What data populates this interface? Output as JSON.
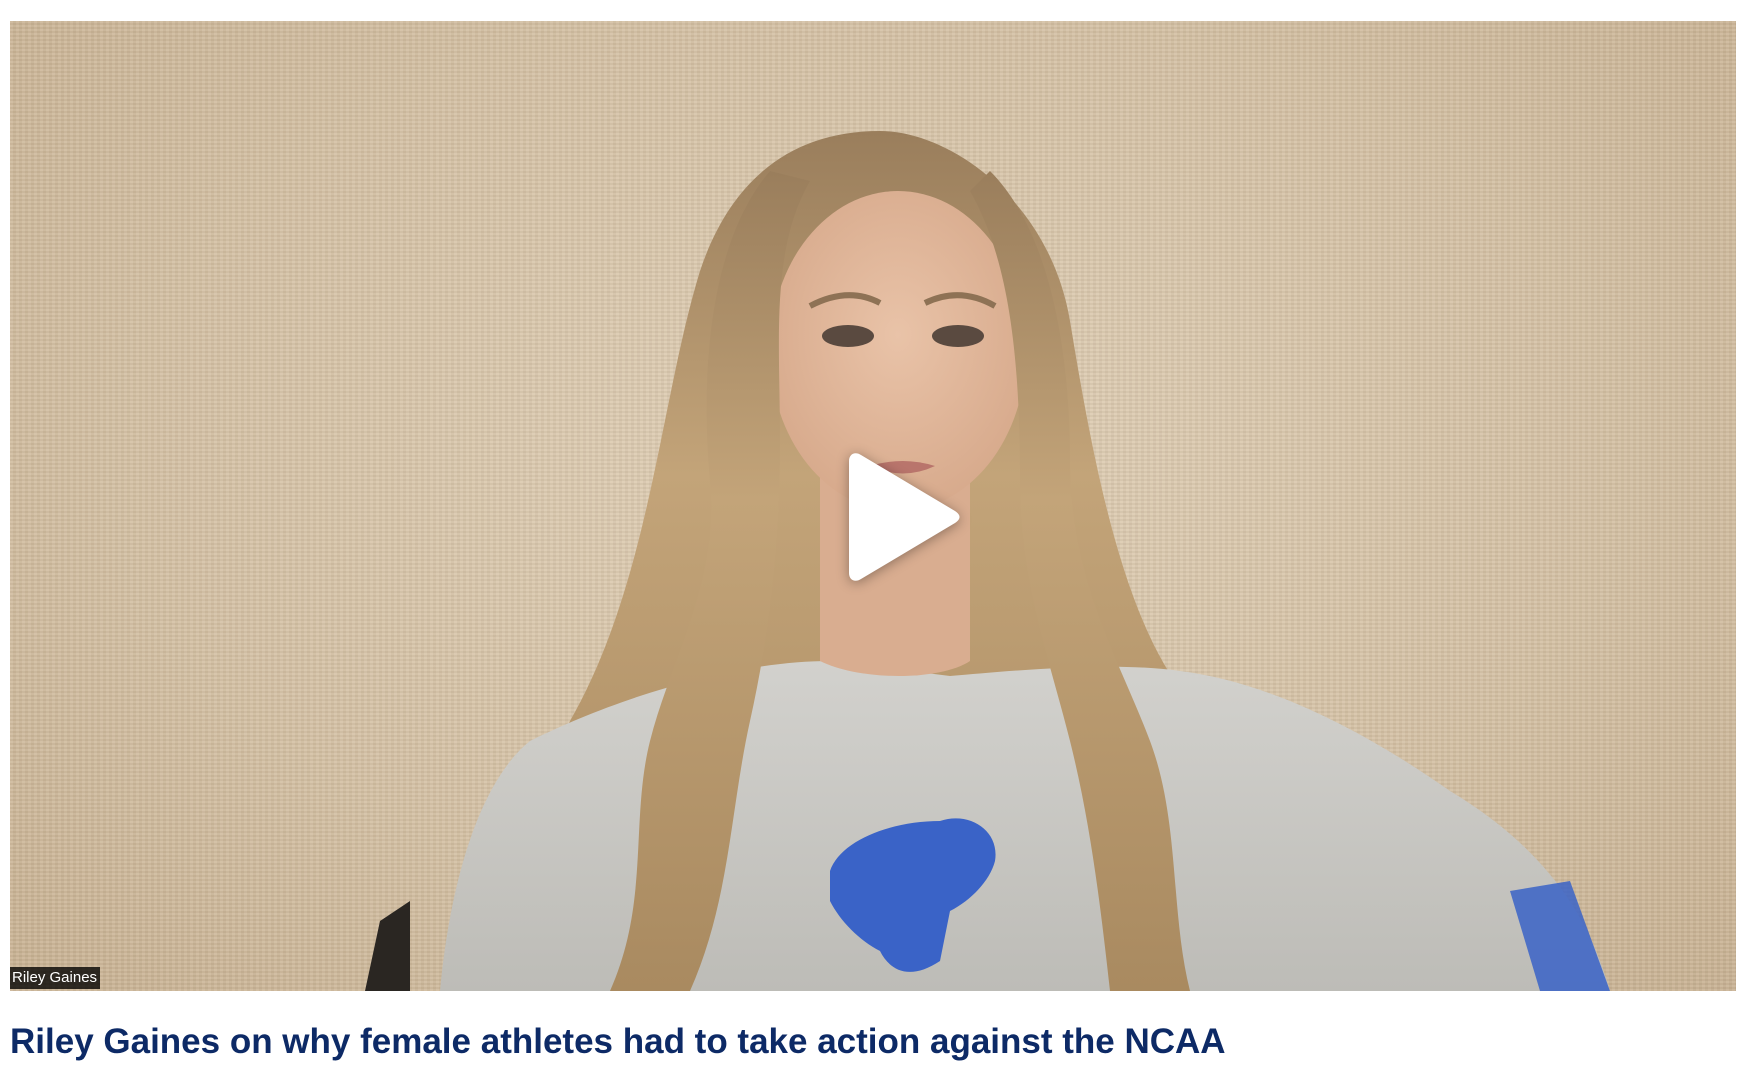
{
  "video": {
    "name_tag": "Riley Gaines",
    "play_icon": "play-icon",
    "title": "Riley Gaines on why female athletes had to take action against the NCAA"
  },
  "colors": {
    "title": "#0d2a66",
    "wall": "#d9c7ad",
    "hair": "#b8976a",
    "hoodie": "#c9c8c4",
    "logo": "#3a63c7",
    "play": "#ffffff"
  }
}
